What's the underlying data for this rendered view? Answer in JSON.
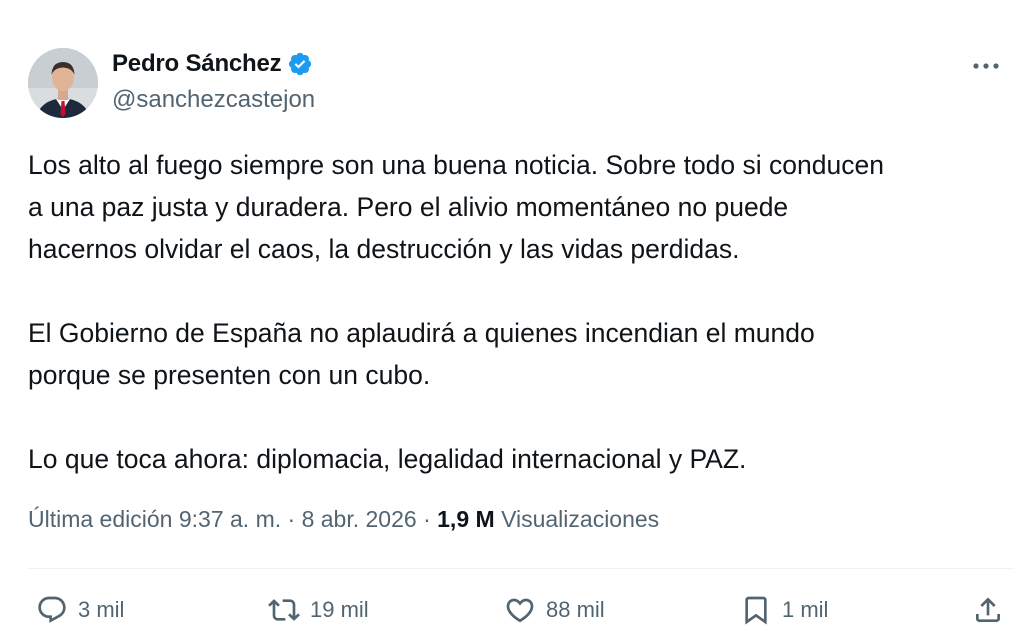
{
  "author": {
    "display_name": "Pedro Sánchez",
    "handle": "@sanchezcastejon",
    "verified_icon": "verified-badge-icon",
    "avatar_icon": "avatar"
  },
  "tweet": {
    "paragraphs": [
      [
        "Los alto al fuego siempre son una buena noticia. Sobre todo si conducen",
        "a una paz justa y duradera. Pero el alivio momentáneo no puede",
        "hacernos olvidar el caos, la destrucción y las vidas perdidas."
      ],
      [
        "El Gobierno de España no aplaudirá a quienes incendian el mundo",
        "porque se presenten con un cubo."
      ],
      [
        "Lo que toca ahora: diplomacia, legalidad internacional y PAZ."
      ]
    ]
  },
  "meta": {
    "edited_label": "Última edición",
    "time": "9:37 a. m.",
    "separator": "·",
    "date": "8 abr. 2026",
    "views_count": "1,9 M",
    "views_label": "Visualizaciones"
  },
  "actions": {
    "replies": "3 mil",
    "retweets": "19 mil",
    "likes": "88 mil",
    "bookmarks": "1 mil"
  },
  "colors": {
    "text_primary": "#0f1419",
    "text_secondary": "#536471",
    "verified_blue": "#1d9bf0",
    "divider": "#eff3f4"
  }
}
